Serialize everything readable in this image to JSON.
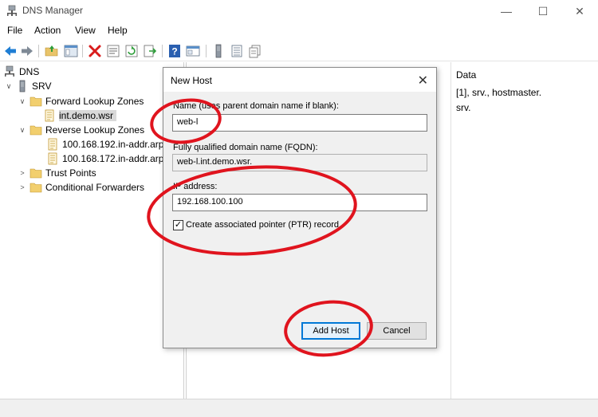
{
  "window": {
    "title": "DNS Manager",
    "minimize": "—",
    "maximize": "☐",
    "close": "✕"
  },
  "menu": [
    "File",
    "Action",
    "View",
    "Help"
  ],
  "toolbar": {
    "icons": [
      "back-icon",
      "forward-icon",
      "up-folder-icon",
      "show-hide-tree-icon",
      "delete-icon",
      "properties-icon",
      "refresh-icon",
      "export-icon",
      "help-icon",
      "console-icon",
      "server-icon",
      "zone-icon",
      "record-icon"
    ]
  },
  "tree": {
    "root": "DNS",
    "server": "SRV",
    "forward": "Forward Lookup Zones",
    "forward_zone": "int.demo.wsr",
    "reverse": "Reverse Lookup Zones",
    "reverse_zones": [
      "100.168.192.in-addr.arpa",
      "100.168.172.in-addr.arpa"
    ],
    "trust": "Trust Points",
    "conditional": "Conditional Forwarders"
  },
  "details": {
    "data_header": "Data",
    "rows": [
      "[1], srv., hostmaster.",
      "srv."
    ]
  },
  "dialog": {
    "title": "New Host",
    "close": "✕",
    "name_label": "Name (uses parent domain name if blank):",
    "name_value": "web-l",
    "fqdn_label": "Fully qualified domain name (FQDN):",
    "fqdn_value": "web-l.int.demo.wsr.",
    "ip_label": "IP address:",
    "ip_value": "192.168.100.100",
    "ptr_label": "Create associated pointer (PTR) record",
    "ptr_checked": true,
    "ptr_mark": "✓",
    "add_button": "Add Host",
    "cancel_button": "Cancel"
  },
  "colors": {
    "annotation": "#e0141e",
    "selection": "#d9d9d9",
    "focus_border": "#0078d7"
  }
}
